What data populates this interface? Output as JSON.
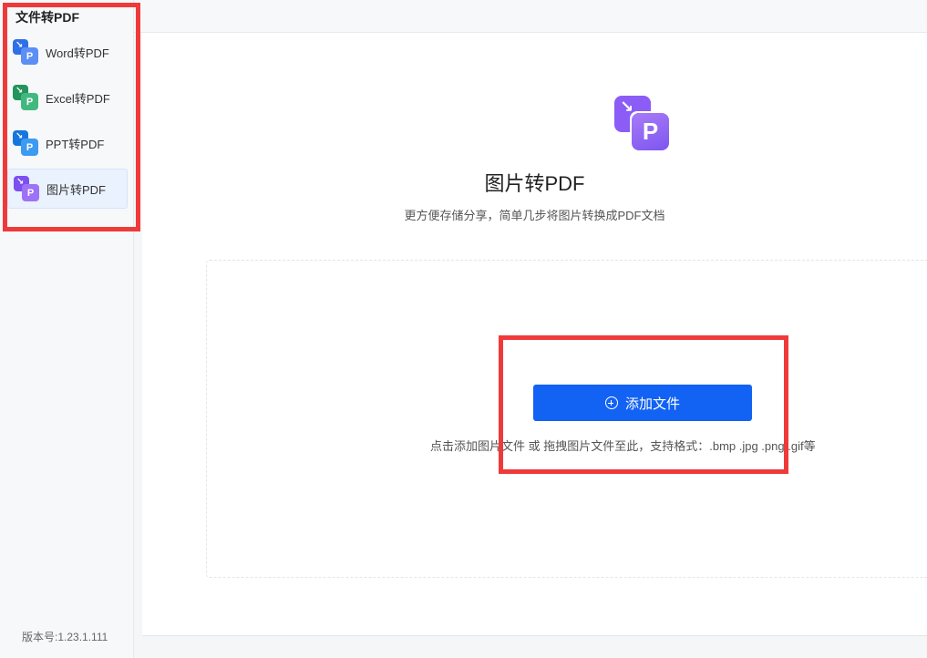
{
  "sidebar": {
    "title": "文件转PDF",
    "items": [
      {
        "label": "Word转PDF",
        "icon": "word-to-pdf-icon",
        "color": "#3b76f0",
        "active": false
      },
      {
        "label": "Excel转PDF",
        "icon": "excel-to-pdf-icon",
        "color": "#2fa36b",
        "active": false
      },
      {
        "label": "PPT转PDF",
        "icon": "ppt-to-pdf-icon",
        "color": "#1f86e8",
        "active": false
      },
      {
        "label": "图片转PDF",
        "icon": "image-to-pdf-icon",
        "color": "#8b5cf6",
        "active": true
      }
    ],
    "version": "版本号:1.23.1.111"
  },
  "main": {
    "icon_letter": "P",
    "title": "图片转PDF",
    "subtitle": "更方便存储分享，简单几步将图片转换成PDF文档",
    "add_button": "添加文件",
    "hint": "点击添加图片文件 或 拖拽图片文件至此，支持格式：.bmp .jpg .png .gif等"
  },
  "colors": {
    "accent": "#1262f4",
    "annotation": "#ef3a3a"
  }
}
